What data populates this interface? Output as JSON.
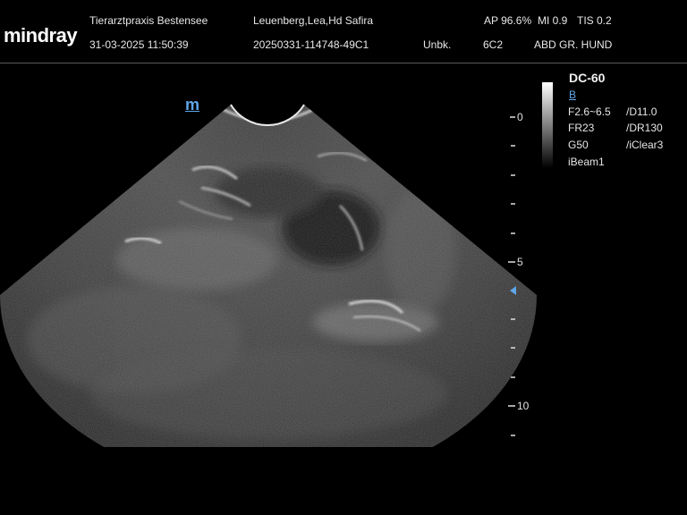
{
  "header": {
    "logo": "mindray",
    "clinic": "Tierarztpraxis Bestensee",
    "datetime": "31-03-2025 11:50:39",
    "patient": "Leuenberg,Lea,Hd Safira",
    "exam_id": "20250331-114748-49C1",
    "operator": "Unbk.",
    "probe": "6C2",
    "ap_readout": "AP 96.6%",
    "mi_readout": "MI 0.9",
    "tis_readout": "TIS 0.2",
    "preset": "ABD GR. HUND"
  },
  "image": {
    "orientation_mark": "m"
  },
  "params": {
    "probe_name": "DC-60",
    "mode": "B",
    "freq": "F2.6~6.5",
    "depth": "/D11.0",
    "frame_rate": "FR23",
    "dynamic_range": "/DR130",
    "gain": "G50",
    "iclear": "/iClear3",
    "ibeam": "iBeam1"
  },
  "depth_scale": {
    "labels": [
      "0",
      "5",
      "10"
    ],
    "color_marker": "#5fa6e8"
  },
  "colors": {
    "background": "#000000",
    "accent": "#5fa6e8",
    "text": "#e6e6e6"
  }
}
